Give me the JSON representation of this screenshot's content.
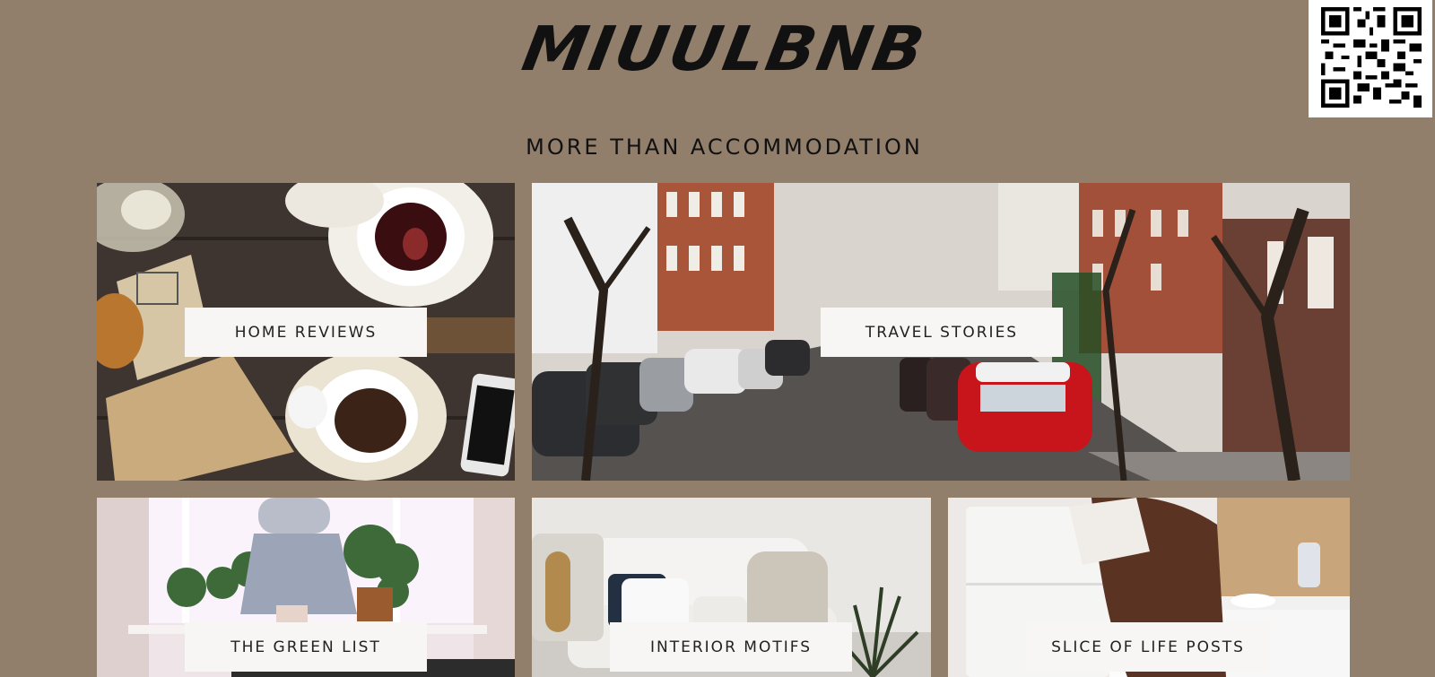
{
  "header": {
    "logo": "MIUULBNB",
    "tagline": "MORE THAN ACCOMMODATION"
  },
  "qr_code": {
    "icon": "qr-code-icon"
  },
  "tiles": [
    {
      "label": "HOME REVIEWS",
      "image": "tea-table-photo"
    },
    {
      "label": "TRAVEL STORIES",
      "image": "street-with-cars-photo"
    },
    {
      "label": "THE GREEN LIST",
      "image": "plants-window-photo"
    },
    {
      "label": "INTERIOR MOTIFS",
      "image": "sofa-interior-photo"
    },
    {
      "label": "SLICE OF LIFE POSTS",
      "image": "kitchen-reading-photo"
    }
  ],
  "colors": {
    "background": "#917e6b",
    "label_box": "#f7f6f4",
    "text": "#111111"
  }
}
